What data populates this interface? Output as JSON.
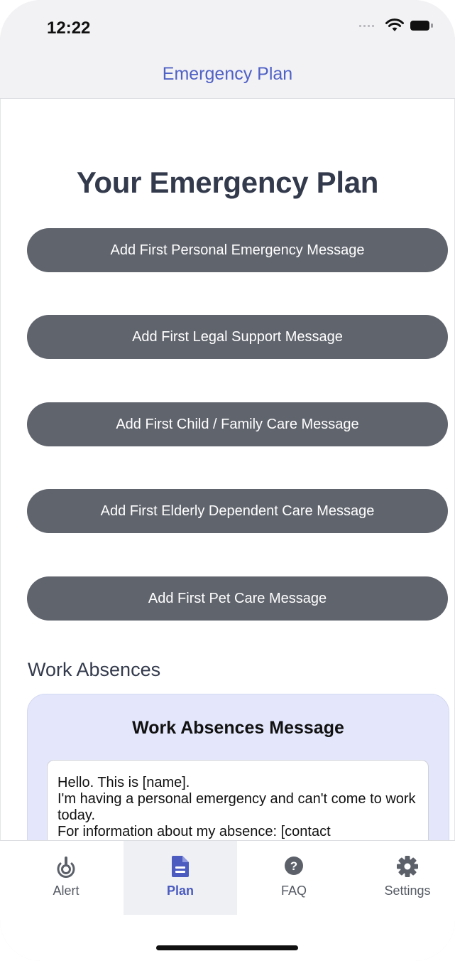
{
  "status_bar": {
    "time": "12:22",
    "icons": [
      "signal-dots-icon",
      "wifi-icon",
      "battery-icon"
    ]
  },
  "nav": {
    "title": "Emergency Plan"
  },
  "page": {
    "title": "Your Emergency Plan",
    "buttons": [
      {
        "label": "Add First Personal Emergency Message"
      },
      {
        "label": "Add First Legal Support Message"
      },
      {
        "label": "Add First Child / Family Care Message"
      },
      {
        "label": "Add First Elderly Dependent Care Message"
      },
      {
        "label": "Add First Pet Care Message"
      }
    ]
  },
  "work_absences": {
    "heading": "Work Absences",
    "card_title": "Work Absences Message",
    "message": "Hello. This is [name].\nI'm having a personal emergency and can't come to work today.\nFor information about my absence: [contact"
  },
  "tabs": [
    {
      "label": "Alert",
      "icon": "alert-icon",
      "active": false
    },
    {
      "label": "Plan",
      "icon": "document-icon",
      "active": true
    },
    {
      "label": "FAQ",
      "icon": "question-icon",
      "active": false
    },
    {
      "label": "Settings",
      "icon": "gear-icon",
      "active": false
    }
  ],
  "colors": {
    "accent": "#4b5bc0",
    "button_bg": "#60646d",
    "card_bg": "#e4e7fb",
    "header_bg": "#f2f2f4"
  }
}
